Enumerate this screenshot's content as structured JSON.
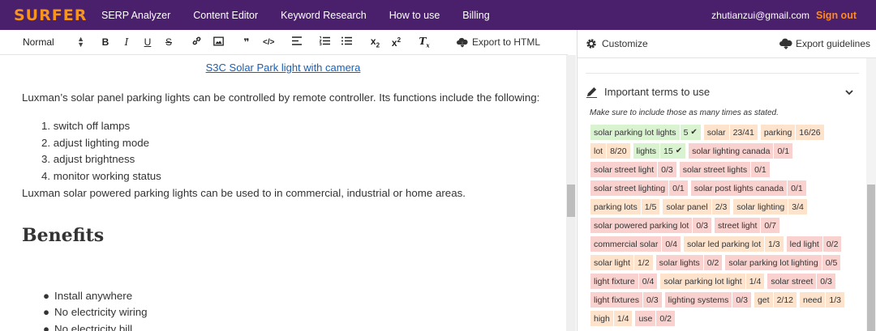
{
  "nav": {
    "logo": "SURFER",
    "links": [
      "SERP Analyzer",
      "Content Editor",
      "Keyword Research",
      "How to use",
      "Billing"
    ],
    "email": "zhutianzui@gmail.com",
    "signout": "Sign out"
  },
  "toolbar": {
    "style_select": "Normal",
    "buttons": [
      "B",
      "I",
      "U",
      "S"
    ],
    "export_html": "Export to HTML"
  },
  "editor": {
    "link_text": "S3C Solar Park light with camera",
    "para1": "Luxman’s solar panel parking lights can be controlled by remote controller. Its functions include the following:",
    "ordered_list": [
      "1. switch off lamps",
      "2. adjust lighting mode",
      "3. adjust brightness",
      "4. monitor working status"
    ],
    "para2": "Luxman solar powered parking lights can be used to in commercial, industrial or home areas.",
    "heading": "Benefits",
    "bullets": [
      "Install anywhere",
      "No electricity wiring",
      "No electricity bill"
    ]
  },
  "sidebar": {
    "customize": "Customize",
    "export_guidelines": "Export guidelines",
    "terms_title": "Important terms to use",
    "terms_note": "Make sure to include those as many times as stated.",
    "terms": [
      {
        "term": "solar parking lot lights",
        "count": "5",
        "status": "green",
        "check": "✔"
      },
      {
        "term": "solar",
        "count": "23/41",
        "status": "orange"
      },
      {
        "term": "parking",
        "count": "16/26",
        "status": "orange"
      },
      {
        "term": "lot",
        "count": "8/20",
        "status": "orange"
      },
      {
        "term": "lights",
        "count": "15",
        "status": "green",
        "check": "✔"
      },
      {
        "term": "solar lighting canada",
        "count": "0/1",
        "status": "red"
      },
      {
        "term": "solar street light",
        "count": "0/3",
        "status": "red"
      },
      {
        "term": "solar street lights",
        "count": "0/1",
        "status": "red"
      },
      {
        "term": "solar street lighting",
        "count": "0/1",
        "status": "red"
      },
      {
        "term": "solar post lights canada",
        "count": "0/1",
        "status": "red"
      },
      {
        "term": "parking lots",
        "count": "1/5",
        "status": "orange"
      },
      {
        "term": "solar panel",
        "count": "2/3",
        "status": "orange"
      },
      {
        "term": "solar lighting",
        "count": "3/4",
        "status": "orange"
      },
      {
        "term": "solar powered parking lot",
        "count": "0/3",
        "status": "red"
      },
      {
        "term": "street light",
        "count": "0/7",
        "status": "red"
      },
      {
        "term": "commercial solar",
        "count": "0/4",
        "status": "red"
      },
      {
        "term": "solar led parking lot",
        "count": "1/3",
        "status": "orange"
      },
      {
        "term": "led light",
        "count": "0/2",
        "status": "red"
      },
      {
        "term": "solar light",
        "count": "1/2",
        "status": "orange"
      },
      {
        "term": "solar lights",
        "count": "0/2",
        "status": "red"
      },
      {
        "term": "solar parking lot lighting",
        "count": "0/5",
        "status": "red"
      },
      {
        "term": "light fixture",
        "count": "0/4",
        "status": "red"
      },
      {
        "term": "solar parking lot light",
        "count": "1/4",
        "status": "orange"
      },
      {
        "term": "solar street",
        "count": "0/3",
        "status": "red"
      },
      {
        "term": "light fixtures",
        "count": "0/3",
        "status": "red"
      },
      {
        "term": "lighting systems",
        "count": "0/3",
        "status": "red"
      },
      {
        "term": "get",
        "count": "2/12",
        "status": "orange"
      },
      {
        "term": "need",
        "count": "1/3",
        "status": "orange"
      },
      {
        "term": "high",
        "count": "1/4",
        "status": "orange"
      },
      {
        "term": "use",
        "count": "0/2",
        "status": "red"
      }
    ]
  },
  "colors": {
    "nav_bg": "#4a1f6b",
    "logo": "#f7941d",
    "signout": "#ff8a1f",
    "link": "#1a5fb4",
    "chip_green": "#d9f2d0",
    "chip_orange": "#fde3cc",
    "chip_red": "#f9d2cf"
  }
}
